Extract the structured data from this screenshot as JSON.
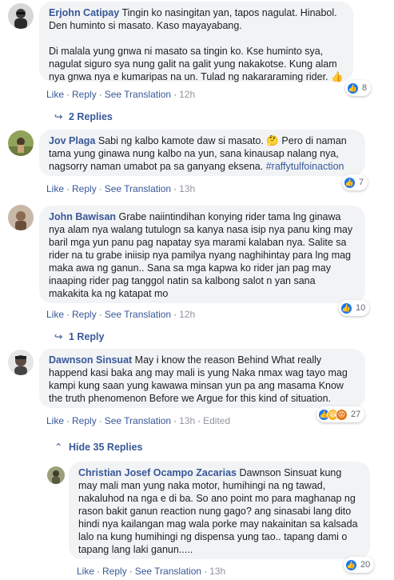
{
  "comments": [
    {
      "author": "Erjohn Catipay",
      "paragraphs": [
        "Tingin ko nasingitan yan, tapos nagulat. Hinabol. Den huminto si masato. Kaso mayayabang.",
        "Di malala yung gnwa ni masato sa tingin ko. Kse huminto sya, nagulat siguro sya nung galit na galit yung nakakotse. Kung alam nya gnwa nya e kumaripas na un. Tulad ng nakararaming rider. 👍"
      ],
      "actions": {
        "like": "Like",
        "reply": "Reply",
        "translate": "See Translation",
        "time": "12h"
      },
      "reactions": {
        "icons": [
          "like"
        ],
        "count": "8"
      }
    },
    {
      "author": "Jov Plaga",
      "text": "Sabi ng kalbo kamote daw si masato. 🤔 Pero di naman tama yung ginawa nung kalbo na yun, sana kinausap nalang nya, nagsorry naman umabot pa sa ganyang eksena. ",
      "hashtag": "#raffytulfoinaction",
      "actions": {
        "like": "Like",
        "reply": "Reply",
        "translate": "See Translation",
        "time": "13h"
      },
      "reactions": {
        "icons": [
          "like"
        ],
        "count": "7"
      }
    },
    {
      "author": "John Bawisan",
      "text": "Grabe naiintindihan konying rider tama lng ginawa nya alam nya walang tutulogn sa kanya nasa isip nya panu king may baril mga yun panu pag napatay sya marami kalaban nya. Salite sa rider na tu grabe iniisip nya pamilya nyang naghihintay para lng mag maka awa ng ganun.. Sana sa mga kapwa ko rider jan pag may inaaping rider pag tanggol natin sa kalbong salot n yan sana makakita ka ng katapat mo",
      "actions": {
        "like": "Like",
        "reply": "Reply",
        "translate": "See Translation",
        "time": "12h"
      },
      "reactions": {
        "icons": [
          "like"
        ],
        "count": "10"
      }
    },
    {
      "author": "Dawnson Sinsuat",
      "text": "May i know the reason Behind What really happend kasi baka ang may mali is yung Naka nmax wag tayo mag kampi kung saan yung kawawa minsan yun pa ang masama Know the truth phenomenon Before we Argue for this kind of situation.",
      "actions": {
        "like": "Like",
        "reply": "Reply",
        "translate": "See Translation",
        "time": "13h",
        "edited": "Edited"
      },
      "reactions": {
        "icons": [
          "like",
          "haha",
          "angry"
        ],
        "count": "27"
      }
    },
    {
      "author": "Christian Josef Ocampo Zacarias",
      "text": "Dawnson Sinsuat kung may mali man yung naka motor, humihingi na ng tawad, nakaluhod na nga e di ba. So ano point mo para maghanap ng rason bakit ganun reaction nung gago? ang sinasabi lang dito hindi nya kailangan mag wala porke may nakainitan sa kalsada lalo na kung humihingi ng dispensa yung tao.. tapang dami o tapang lang laki ganun.....",
      "actions": {
        "like": "Like",
        "reply": "Reply",
        "translate": "See Translation",
        "time": "13h"
      },
      "reactions": {
        "icons": [
          "like"
        ],
        "count": "20"
      }
    }
  ],
  "reply_links": [
    {
      "arrow": "↪",
      "label": "2 Replies"
    },
    {
      "arrow": "↪",
      "label": "1 Reply"
    },
    {
      "arrow": "⌃",
      "label": "Hide 35 Replies"
    }
  ],
  "colors": {
    "link": "#385898",
    "bubble": "#f2f3f5",
    "like_blue": "#1877f2",
    "muted": "#90949c"
  }
}
